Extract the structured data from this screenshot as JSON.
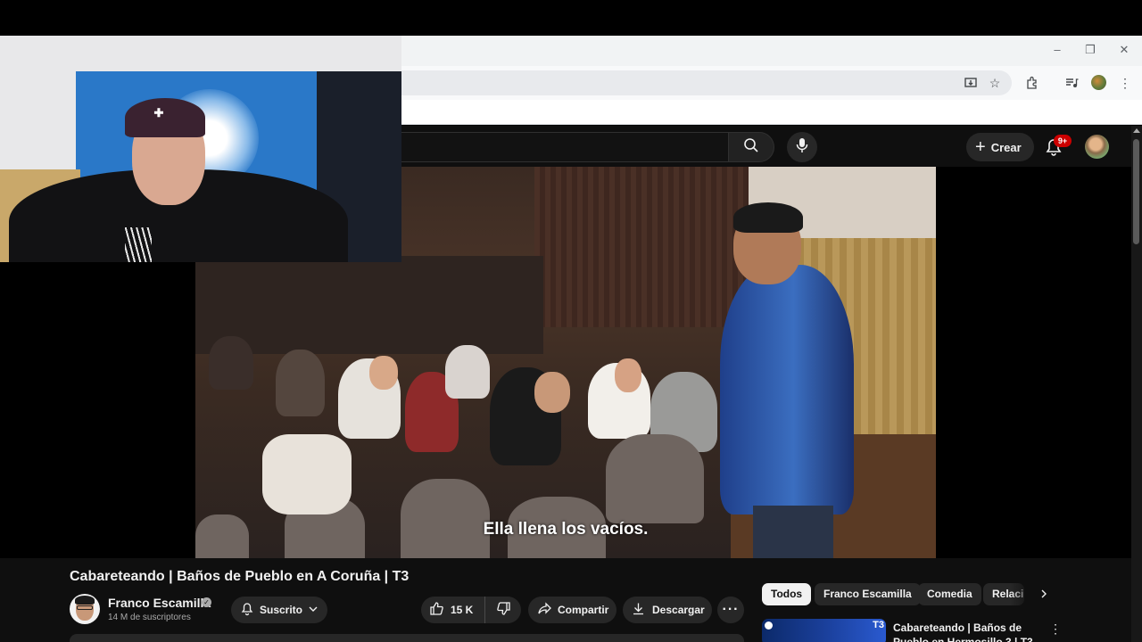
{
  "browser": {
    "window_controls": {
      "minimize": "–",
      "restore": "❐",
      "close": "✕"
    },
    "toolbar_icons": [
      "install-app-icon",
      "bookmark-star-icon",
      "extensions-icon",
      "media-controls-icon",
      "profile-icon",
      "kebab-menu-icon"
    ]
  },
  "youtube": {
    "header": {
      "create_label": "Crear",
      "notifications_badge": "9+"
    },
    "video": {
      "subtitle": "Ella llena los vacíos.",
      "title": "Cabareteando | Baños de Pueblo en A Coruña | T3"
    },
    "channel": {
      "name": "Franco Escamilla",
      "subscribers": "14 M de suscriptores",
      "subscribed_label": "Suscrito"
    },
    "actions": {
      "likes": "15 K",
      "share_label": "Compartir",
      "download_label": "Descargar"
    },
    "chips": [
      "Todos",
      "Franco Escamilla",
      "Comedia",
      "Relaci"
    ],
    "related": [
      {
        "title": "Cabareteando | Baños de Pueblo en Hermosillo 3 | T3",
        "badge": "T3"
      }
    ]
  }
}
